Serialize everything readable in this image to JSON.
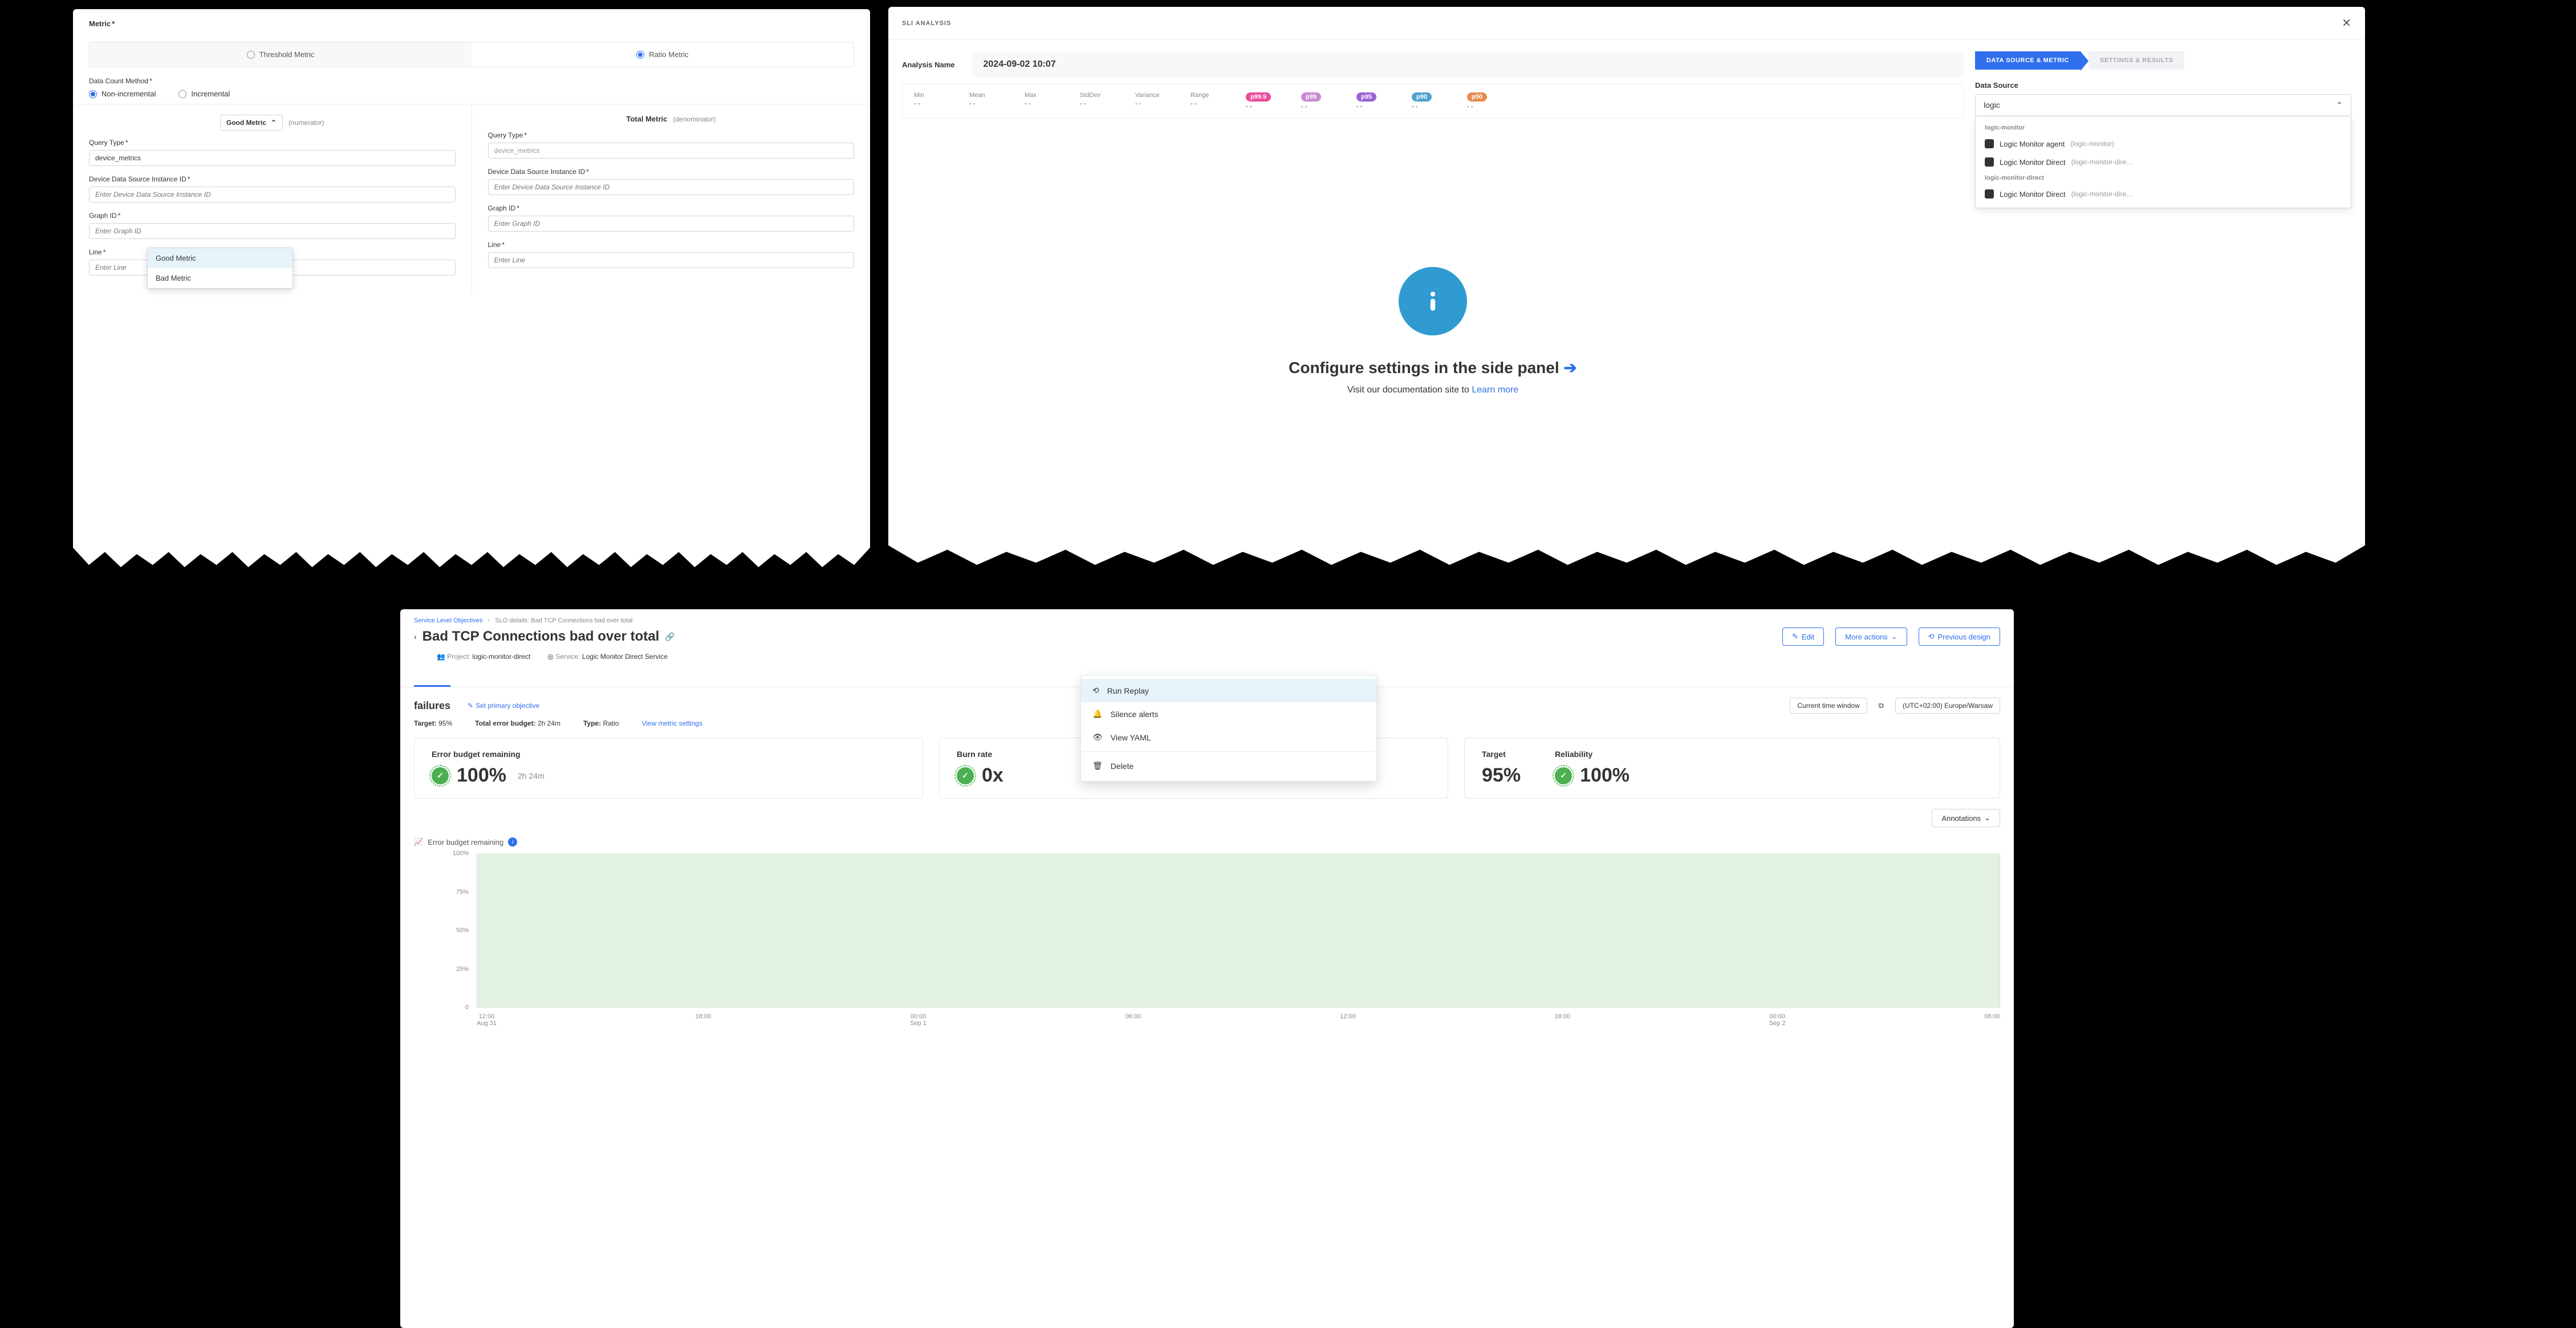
{
  "p1": {
    "metric_label": "Metric",
    "tab_threshold": "Threshold Metric",
    "tab_ratio": "Ratio Metric",
    "count_method_label": "Data Count Method",
    "non_incremental": "Non-incremental",
    "incremental": "Incremental",
    "good_metric_btn": "Good Metric",
    "numerator_hint": "(numerator)",
    "total_metric_label": "Total Metric",
    "denominator_hint": "(denominator)",
    "query_type_label": "Query Type",
    "device_metrics": "device_metrics",
    "device_ds_label": "Device Data Source Instance ID",
    "device_ds_placeholder": "Enter Device Data Source Instance ID",
    "graph_id_label": "Graph ID",
    "graph_id_placeholder": "Enter Graph ID",
    "line_label": "Line",
    "line_placeholder": "Enter Line",
    "dropdown": {
      "good": "Good Metric",
      "bad": "Bad Metric"
    }
  },
  "p2": {
    "title": "SLI ANALYSIS",
    "analysis_name_label": "Analysis Name",
    "analysis_name_value": "2024-09-02 10:07",
    "stats": [
      "Min",
      "Mean",
      "Max",
      "StdDev",
      "Variance",
      "Range"
    ],
    "dash": "- -",
    "pills": [
      {
        "label": "p99.9",
        "color": "#e94b9c"
      },
      {
        "label": "p99",
        "color": "#c78bd1"
      },
      {
        "label": "p95",
        "color": "#9c63d4"
      },
      {
        "label": "p90",
        "color": "#4fa3d1"
      },
      {
        "label": "p50",
        "color": "#e88b4f"
      }
    ],
    "empty_heading": "Configure settings in the side panel",
    "empty_text_prefix": "Visit our documentation site to ",
    "empty_link": "Learn more",
    "step_on": "DATA SOURCE & METRIC",
    "step_off": "SETTINGS & RESULTS",
    "ds_label": "Data Source",
    "ds_value": "logic",
    "ds_groups": [
      {
        "name": "logic-monitor",
        "items": [
          {
            "name": "Logic Monitor agent",
            "sub": "(logic-monitor)"
          },
          {
            "name": "Logic Monitor Direct",
            "sub": "(logic-monitor-dire…"
          }
        ]
      },
      {
        "name": "logic-monitor-direct",
        "items": [
          {
            "name": "Logic Monitor Direct",
            "sub": "(logic-monitor-dire…"
          }
        ]
      }
    ]
  },
  "p3": {
    "crumbs": {
      "a": "Service Level Objectives",
      "b": "SLO details: Bad TCP Connections bad over total"
    },
    "title": "Bad TCP Connections bad over total",
    "edit": "Edit",
    "more": "More actions",
    "prev": "Previous design",
    "project_label": "Project:",
    "project_value": "logic-monitor-direct",
    "service_label": "Service:",
    "service_value": "Logic Monitor Direct Service",
    "more_menu": {
      "run": "Run Replay",
      "silence": "Silence alerts",
      "yaml": "View YAML",
      "delete": "Delete"
    },
    "obj_name": "failures",
    "set_primary": "Set primary objective",
    "target_label": "Target:",
    "target_value": "95%",
    "budget_label": "Total error budget:",
    "budget_value": "2h 24m",
    "type_label": "Type:",
    "type_value": "Ratio",
    "view_settings": "View metric settings",
    "tw_label": "Current time window",
    "tz_value": "(UTC+02:00) Europe/Warsaw",
    "annotations": "Annotations",
    "cards": {
      "ebr_label": "Error budget remaining",
      "ebr_value": "100%",
      "ebr_sub": "2h 24m",
      "burn_label": "Burn rate",
      "burn_value": "0x",
      "target_label": "Target",
      "target_value": "95%",
      "rel_label": "Reliability",
      "rel_value": "100%"
    },
    "chart_label": "Error budget remaining"
  },
  "chart_data": {
    "type": "area",
    "title": "Error budget remaining",
    "ylabel": "",
    "ylim": [
      0,
      100
    ],
    "y_ticks": [
      "100%",
      "75%",
      "50%",
      "25%",
      "0"
    ],
    "x_ticks": [
      {
        "t": "12:00",
        "d": "Aug 31"
      },
      {
        "t": "18:00",
        "d": ""
      },
      {
        "t": "00:00",
        "d": "Sep 1"
      },
      {
        "t": "06:00",
        "d": ""
      },
      {
        "t": "12:00",
        "d": ""
      },
      {
        "t": "18:00",
        "d": ""
      },
      {
        "t": "00:00",
        "d": "Sep 2"
      },
      {
        "t": "06:00",
        "d": ""
      }
    ],
    "series": [
      {
        "name": "Error budget remaining",
        "values": [
          100,
          100,
          100,
          100,
          100,
          100,
          100,
          100
        ]
      }
    ]
  }
}
